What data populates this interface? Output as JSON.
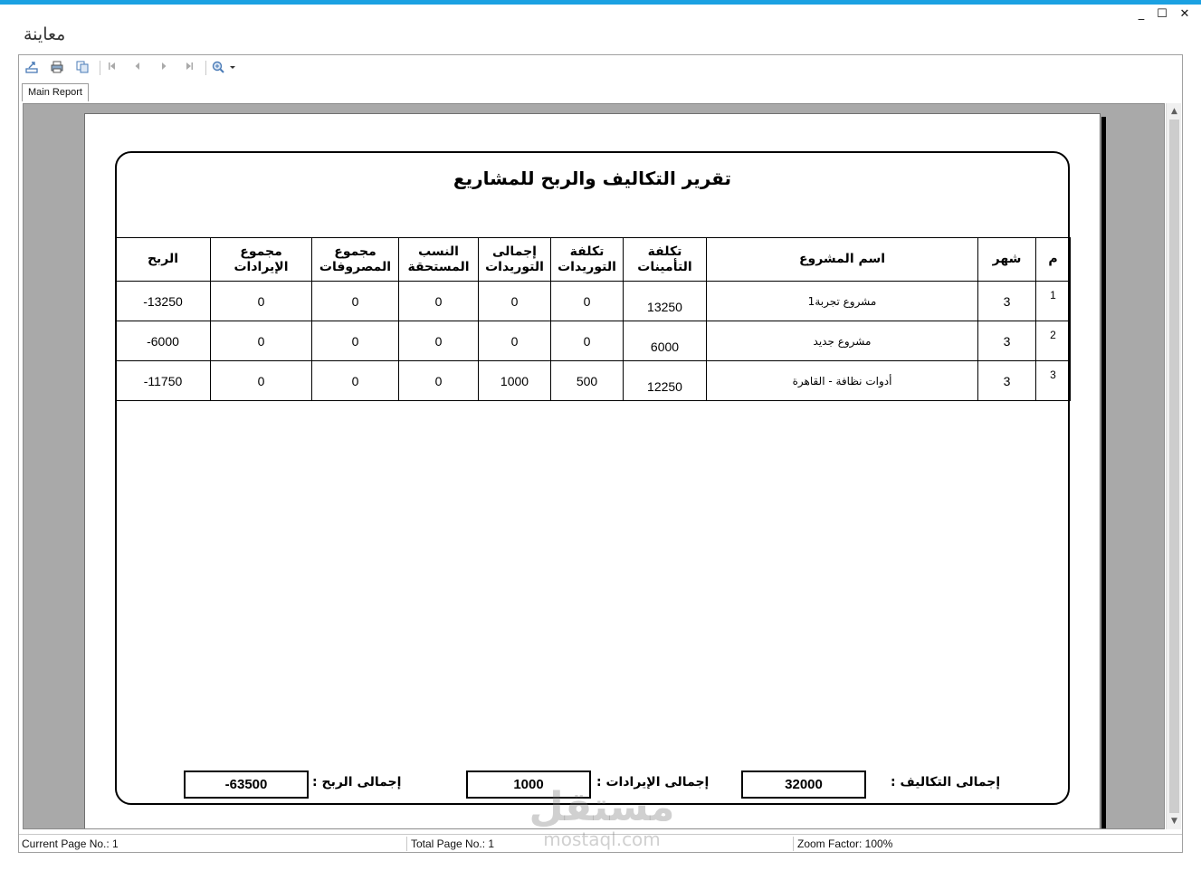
{
  "window": {
    "title": "معاينة",
    "minimize": "_",
    "maximize": "☐",
    "close": "✕"
  },
  "toolbar": {
    "export_icon": "export-icon",
    "print_icon": "print-icon",
    "copy_icon": "copy-icon",
    "first_icon": "first-page-icon",
    "prev_icon": "prev-page-icon",
    "next_icon": "next-page-icon",
    "last_icon": "last-page-icon",
    "zoom_icon": "zoom-icon"
  },
  "tabs": {
    "main": "Main Report"
  },
  "report": {
    "title": "تقرير التكاليف والربح للمشاريع",
    "headers": {
      "serial": "م",
      "month": "شهر",
      "project": "اسم المشروع",
      "insurance_1": "تكلفة",
      "insurance_2": "التأمينات",
      "supply_cost_1": "تكلفة",
      "supply_cost_2": "التوريدات",
      "supply_total_1": "إجمالى",
      "supply_total_2": "التوريدات",
      "percent_1": "النسب",
      "percent_2": "المستحقة",
      "expenses_1": "مجموع",
      "expenses_2": "المصروفات",
      "revenue_1": "مجموع",
      "revenue_2": "الإيرادات",
      "profit": "الربح"
    },
    "rows": [
      {
        "serial": "1",
        "month": "3",
        "project": "مشروع تجربة1",
        "insurance": "13250",
        "supply_cost": "0",
        "supply_total": "0",
        "percent": "0",
        "expenses": "0",
        "revenue": "0",
        "profit": "13250-"
      },
      {
        "serial": "2",
        "month": "3",
        "project": "مشروع جديد",
        "insurance": "6000",
        "supply_cost": "0",
        "supply_total": "0",
        "percent": "0",
        "expenses": "0",
        "revenue": "0",
        "profit": "6000-"
      },
      {
        "serial": "3",
        "month": "3",
        "project": "أدوات نظافة - القاهرة",
        "insurance": "12250",
        "supply_cost": "500",
        "supply_total": "1000",
        "percent": "0",
        "expenses": "0",
        "revenue": "0",
        "profit": "11750-"
      }
    ],
    "totals": {
      "costs_label": "إجمالى التكاليف :",
      "costs_value": "32000",
      "revenue_label": "إجمالى الإيرادات :",
      "revenue_value": "1000",
      "profit_label": "إجمالى الربح :",
      "profit_value": "-63500"
    }
  },
  "status": {
    "current_page": "Current Page No.: 1",
    "total_pages": "Total Page No.: 1",
    "zoom": "Zoom Factor: 100%"
  },
  "watermark": {
    "arabic": "مستقل",
    "latin": "mostaql.com"
  }
}
